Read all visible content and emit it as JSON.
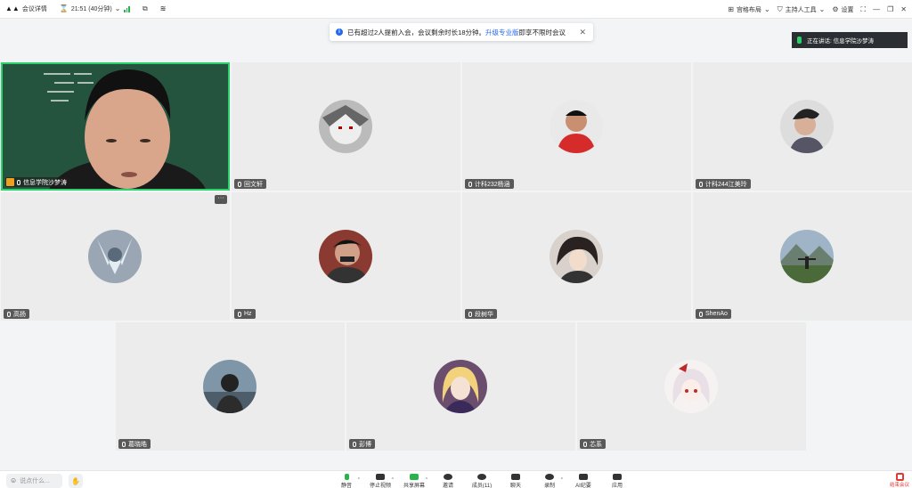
{
  "topbar": {
    "meeting_details": "会议详情",
    "timer": "21:51 (40分钟)",
    "view_layout": "宫格布局",
    "host_tools": "主持人工具",
    "settings": "设置"
  },
  "notice": {
    "text_before": "已有超过2人提前入会，会议剩余时长18分钟。",
    "link": "升级专业版",
    "text_after": "即享不限时会议"
  },
  "speaking": {
    "label": "正在讲话: 信息学院沙梦涛"
  },
  "tiles": [
    {
      "name": "信息学院沙梦涛",
      "host": true
    },
    {
      "name": "回文轩"
    },
    {
      "name": "计科232杨涵"
    },
    {
      "name": "计科244江美玲"
    },
    {
      "name": "高扬"
    },
    {
      "name": "Hz"
    },
    {
      "name": "段树华"
    },
    {
      "name": "ShenAo"
    },
    {
      "name": "葛晓皓"
    },
    {
      "name": "彭博"
    },
    {
      "name": "芯系"
    }
  ],
  "bottombar": {
    "chat_placeholder": "说点什么...",
    "tools": [
      {
        "label": "静音"
      },
      {
        "label": "停止视频"
      },
      {
        "label": "共享屏幕"
      },
      {
        "label": "邀请"
      },
      {
        "label": "成员(11)"
      },
      {
        "label": "聊天"
      },
      {
        "label": "录制"
      },
      {
        "label": "AI纪要"
      },
      {
        "label": "应用"
      }
    ],
    "end_label": "结束会议"
  },
  "colors": {
    "active_speaker_border": "#2bd16b",
    "accent": "#2468f2",
    "end": "#e53935"
  }
}
